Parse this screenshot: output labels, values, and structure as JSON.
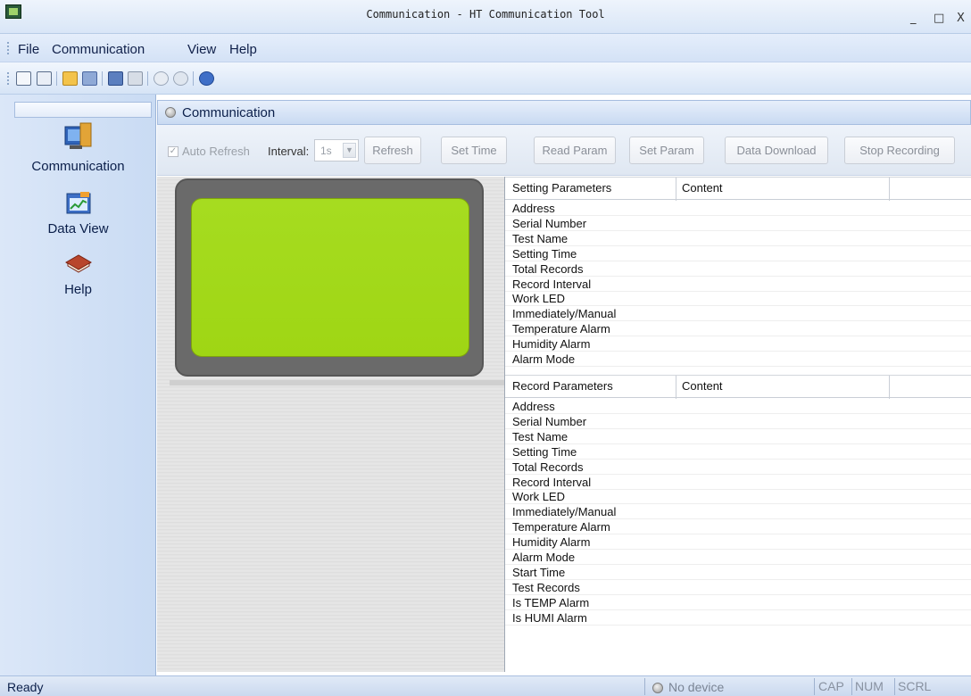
{
  "window": {
    "title": "Communication - HT Communication Tool",
    "minimize": "_",
    "maximize": "□",
    "close": "X"
  },
  "menu": [
    "File",
    "Communication",
    "View",
    "Help"
  ],
  "toolbar_icons": [
    "new-icon",
    "save-icon",
    "open-folder-icon",
    "export-icon",
    "disk-icon",
    "hand-icon",
    "target-icon",
    "refresh-icon",
    "help-icon"
  ],
  "nav": {
    "items": [
      {
        "label": "Communication",
        "icon": "communication-icon"
      },
      {
        "label": "Data View",
        "icon": "data-view-icon"
      },
      {
        "label": "Help",
        "icon": "help-book-icon"
      }
    ]
  },
  "panel": {
    "title": "Communication"
  },
  "actions": {
    "auto_refresh_label": "Auto Refresh",
    "auto_refresh_checked": true,
    "interval_label": "Interval:",
    "interval_value": "1s",
    "refresh": "Refresh",
    "set_time": "Set Time",
    "read_param": "Read Param",
    "set_param": "Set Param",
    "data_download": "Data Download",
    "stop_recording": "Stop Recording"
  },
  "setting_table": {
    "headers": [
      "Setting Parameters",
      "Content"
    ],
    "rows": [
      "Address",
      "Serial Number",
      "Test Name",
      "Setting Time",
      "Total Records",
      "Record Interval",
      "Work LED",
      "Immediately/Manual",
      "Temperature Alarm",
      "Humidity Alarm",
      "Alarm Mode"
    ]
  },
  "record_table": {
    "headers": [
      "Record Parameters",
      "Content"
    ],
    "rows": [
      "Address",
      "Serial Number",
      "Test Name",
      "Setting Time",
      "Total Records",
      "Record Interval",
      "Work LED",
      "Immediately/Manual",
      "Temperature Alarm",
      "Humidity Alarm",
      "Alarm Mode",
      "Start Time",
      "Test Records",
      "Is TEMP Alarm",
      "Is HUMI Alarm"
    ]
  },
  "status": {
    "text": "Ready",
    "device": "No device",
    "indicators": [
      "CAP",
      "NUM",
      "SCRL"
    ]
  },
  "colors": {
    "lcd": "#a2d81a",
    "lcd_frame": "#6a6a6a",
    "accent": "#0b1f4a"
  }
}
